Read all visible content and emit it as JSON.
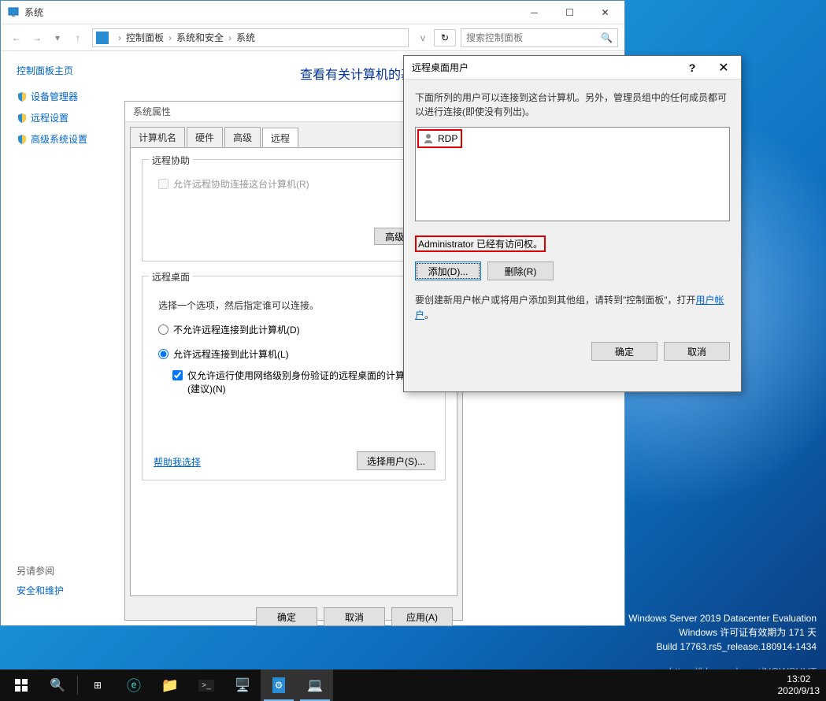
{
  "system_window": {
    "title": "系统",
    "breadcrumb": {
      "root_icon": "monitor",
      "items": [
        "控制面板",
        "系统和安全",
        "系统"
      ]
    },
    "search_placeholder": "搜索控制面板",
    "sidebar": {
      "title": "控制面板主页",
      "items": [
        "设备管理器",
        "远程设置",
        "高级系统设置"
      ],
      "footer_heading": "另请参阅",
      "footer_items": [
        "安全和维护"
      ]
    },
    "main_heading": "查看有关计算机的基本信息"
  },
  "sys_props": {
    "title": "系统属性",
    "tabs": [
      "计算机名",
      "硬件",
      "高级",
      "远程"
    ],
    "active_tab": 3,
    "remote_assist": {
      "group_title": "远程协助",
      "checkbox_label": "允许远程协助连接这台计算机(R)",
      "advanced_btn": "高级(V)..."
    },
    "remote_desktop": {
      "group_title": "远程桌面",
      "description": "选择一个选项，然后指定谁可以连接。",
      "radio_disallow": "不允许远程连接到此计算机(D)",
      "radio_allow": "允许远程连接到此计算机(L)",
      "nla_checkbox": "仅允许运行使用网络级别身份验证的远程桌面的计算机连接(建议)(N)",
      "help_link": "帮助我选择",
      "select_users_btn": "选择用户(S)..."
    },
    "buttons": {
      "ok": "确定",
      "cancel": "取消",
      "apply": "应用(A)"
    }
  },
  "rdp_dialog": {
    "title": "远程桌面用户",
    "description": "下面所列的用户可以连接到这台计算机。另外，管理员组中的任何成员都可以进行连接(即使没有列出)。",
    "user_list": [
      "RDP"
    ],
    "admin_note": "Administrator 已经有访问权。",
    "add_btn": "添加(D)...",
    "remove_btn": "删除(R)",
    "create_text_prefix": "要创建新用户帐户或将用户添加到其他组，请转到\"控制面板\"，打开",
    "create_link": "用户帐户",
    "create_suffix": "。",
    "ok": "确定",
    "cancel": "取消"
  },
  "watermark": {
    "line1": "Windows Server 2019 Datacenter Evaluation",
    "line2": "Windows 许可证有效期为 171 天",
    "line3": "Build 17763.rs5_release.180914-1434",
    "url": "https://blog.csdn.net/NOWSHUT"
  },
  "clock": {
    "time": "13:02",
    "date": "2020/9/13"
  }
}
